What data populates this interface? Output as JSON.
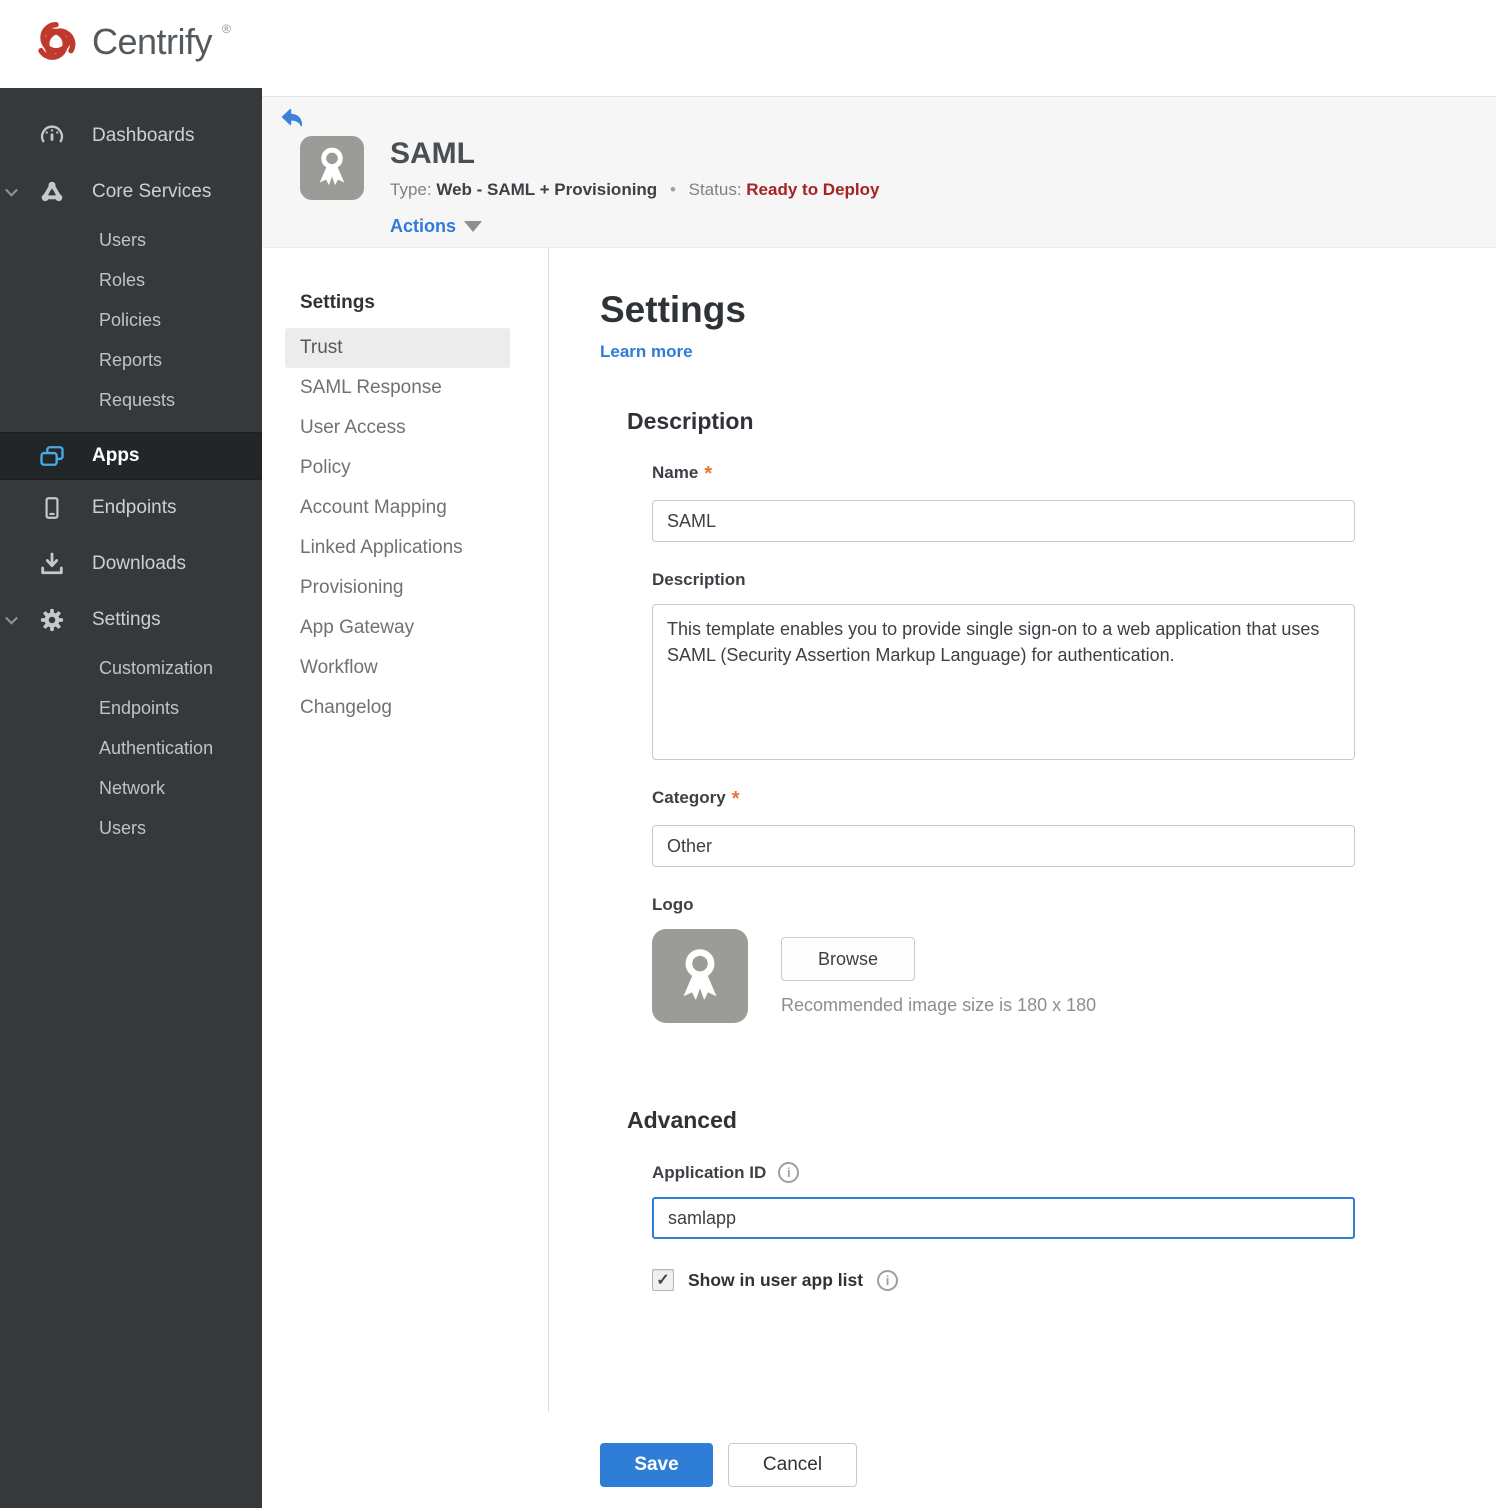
{
  "brand": {
    "name": "Centrify",
    "registered": "®"
  },
  "colors": {
    "accent_blue": "#2e7ed8",
    "link_blue": "#2d7cd6",
    "status_red": "#a32422",
    "logo_red": "#c0392f",
    "asterisk_orange": "#e8762c",
    "sidebar_bg": "#35393b",
    "sidebar_active_bg": "#232628",
    "apps_icon_blue": "#4aa9e8",
    "header_band": "#f6f6f7"
  },
  "sidebar": {
    "items": [
      {
        "label": "Dashboards",
        "icon": "gauge-icon"
      },
      {
        "label": "Core Services",
        "icon": "core-services-icon",
        "expanded": true,
        "children": [
          "Users",
          "Roles",
          "Policies",
          "Reports",
          "Requests"
        ]
      },
      {
        "label": "Apps",
        "icon": "apps-icon",
        "active": true
      },
      {
        "label": "Endpoints",
        "icon": "phone-icon"
      },
      {
        "label": "Downloads",
        "icon": "download-icon"
      },
      {
        "label": "Settings",
        "icon": "gear-icon",
        "expanded": true,
        "children": [
          "Customization",
          "Endpoints",
          "Authentication",
          "Network",
          "Users"
        ]
      }
    ]
  },
  "app_header": {
    "title": "SAML",
    "type_label": "Type:",
    "type_value": "Web - SAML + Provisioning",
    "separator": "•",
    "status_label": "Status:",
    "status_value": "Ready to Deploy",
    "actions_label": "Actions"
  },
  "subnav": {
    "title": "Settings",
    "active_item": "Trust",
    "items": [
      "Trust",
      "SAML Response",
      "User Access",
      "Policy",
      "Account Mapping",
      "Linked Applications",
      "Provisioning",
      "App Gateway",
      "Workflow",
      "Changelog"
    ]
  },
  "main": {
    "title": "Settings",
    "learn_more": "Learn more",
    "required_marker": "*",
    "description": {
      "heading": "Description",
      "name_label": "Name",
      "name_value": "SAML",
      "description_label": "Description",
      "description_value": "This template enables you to provide single sign-on to a web application that uses SAML (Security Assertion Markup Language) for authentication.",
      "category_label": "Category",
      "category_value": "Other",
      "logo_label": "Logo",
      "browse_label": "Browse",
      "recommended_text": "Recommended image size is 180 x 180"
    },
    "advanced": {
      "heading": "Advanced",
      "application_id_label": "Application ID",
      "application_id_value": "samlapp",
      "show_in_user_app_list_label": "Show in user app list",
      "checkbox_checked": true
    }
  },
  "icons": {
    "info": "i",
    "check": "✓"
  },
  "footer": {
    "save_label": "Save",
    "cancel_label": "Cancel"
  }
}
